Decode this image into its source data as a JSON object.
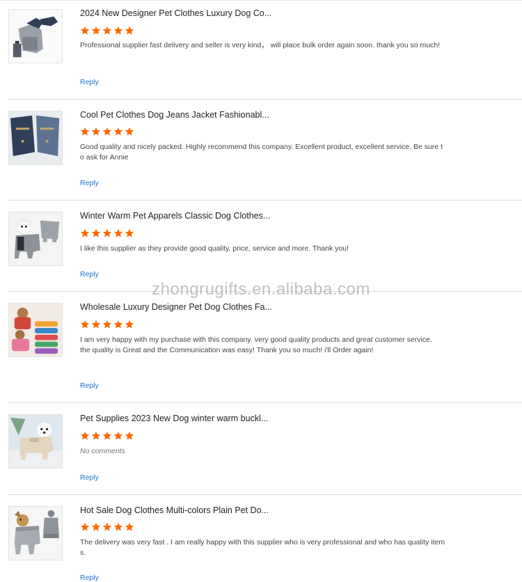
{
  "watermark": "zhongrugifts.en.alibaba.com",
  "star_color": "#ff6a00",
  "reviews": [
    {
      "title": "2024 New Designer Pet Clothes Luxury Dog Co...",
      "rating": 5,
      "comment": "Professional supplier fast delivery and seller is very kind， will place bulk order again soon. thank you so much!",
      "reply_label": "Reply",
      "image": "dog-coat-navy-image"
    },
    {
      "title": "Cool Pet Clothes Dog Jeans Jacket Fashionabl...",
      "rating": 5,
      "comment": "Good quality and nicely packed. Highly recommend this company. Excellent product, excellent service. Be sure to ask for Annie",
      "reply_label": "Reply",
      "image": "denim-jacket-image"
    },
    {
      "title": "Winter Warm Pet Apparels Classic Dog Clothes...",
      "rating": 5,
      "comment": "I like this supplier as they provide good quality, price, service and more. Thank you!",
      "reply_label": "Reply",
      "image": "grey-jumpsuit-image"
    },
    {
      "title": "Wholesale Luxury Designer Pet Dog Clothes Fa...",
      "rating": 5,
      "comment": "I am very happy with my purchase with this company. very good quality products and great customer service.\nthe quality is Great and the Communication was easy! Thank you so much! i'll Order again!",
      "reply_label": "Reply",
      "image": "colorful-puffer-image"
    },
    {
      "title": "Pet Supplies 2023 New Dog winter warm buckl...",
      "rating": 5,
      "comment": "No comments",
      "comment_empty": true,
      "reply_label": "Reply",
      "image": "beige-coat-image"
    },
    {
      "title": "Hot Sale Dog Clothes Multi-colors Plain Pet Do...",
      "rating": 5,
      "comment": "The delivery was very fast . I am really happy with this supplier who is very professional and who has quality items.",
      "reply_label": "Reply",
      "image": "grey-sweater-image"
    }
  ]
}
